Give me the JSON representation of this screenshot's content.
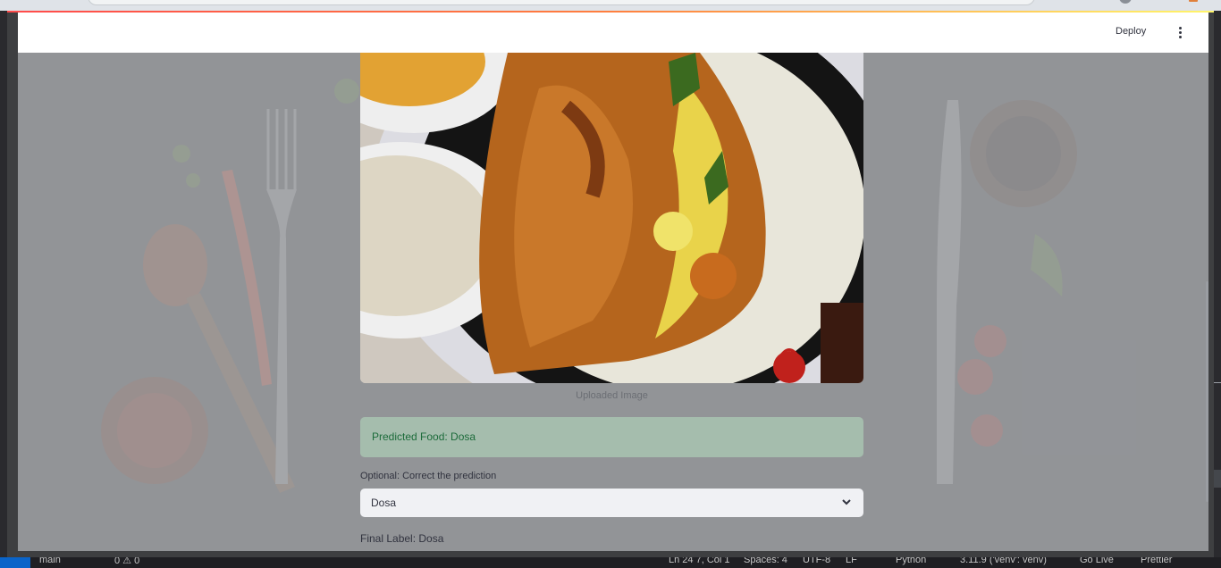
{
  "header": {
    "deploy_label": "Deploy"
  },
  "main": {
    "image_caption": "Uploaded Image",
    "prediction_text": "Predicted Food: Dosa",
    "correction_label": "Optional: Correct the prediction",
    "correction_value": "Dosa",
    "final_label_text": "Final Label: Dosa"
  },
  "statusbar": {
    "branch": "main",
    "problems": "0 ⚠ 0",
    "cursor": "Ln 24 7, Col 1",
    "spaces": "Spaces: 4",
    "encoding": "UTF-8",
    "eol": "LF",
    "language": "Python",
    "interpreter": "3.11.9 ('venv': venv)",
    "golive": "Go Live",
    "prettier": "Prettier"
  },
  "colors": {
    "success_text": "#1c6b3a",
    "success_bg": "#accdb5",
    "accent_gradient": [
      "#ff4b4b",
      "#fff56a"
    ]
  },
  "icons": [
    "more-vertical-icon",
    "chevron-down-icon",
    "branch-icon"
  ]
}
